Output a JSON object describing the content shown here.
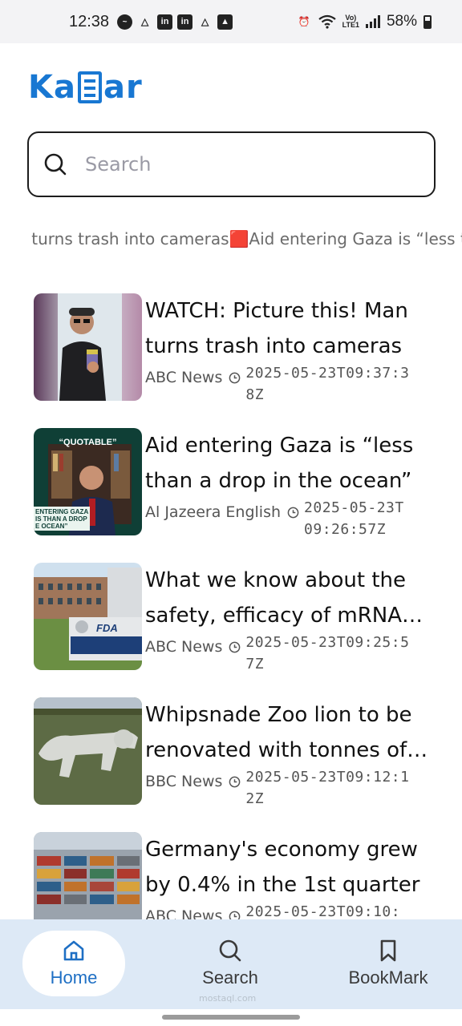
{
  "status_bar": {
    "time": "12:38",
    "battery": "58%",
    "network": "LTE1"
  },
  "app": {
    "logo_left": "Ka",
    "logo_right": "ar",
    "brand_color": "#1877d2"
  },
  "search": {
    "placeholder": "Search"
  },
  "ticker": {
    "text": "an turns trash into cameras🟥Aid entering Gaza is “less than a drop in the ocean”"
  },
  "articles": [
    {
      "title": "WATCH: Picture this! Man turns trash into cameras",
      "source": "ABC News",
      "time": "2025-05-23T09:37:38Z"
    },
    {
      "title": "Aid entering Gaza is “less than a drop in the ocean”",
      "source": "Al Jazeera English",
      "time": "2025-05-23T09:26:57Z",
      "thumb_caption": "“QUOTABLE”",
      "thumb_lower": "ENTERING GAZA IS THAN A DROP E OCEAN”"
    },
    {
      "title": "What we know about the safety, efficacy of mRNA vaccines",
      "source": "ABC News",
      "time": "2025-05-23T09:25:57Z",
      "thumb_sign": "FDA"
    },
    {
      "title": "Whipsnade Zoo lion to be renovated with tonnes of chalk",
      "source": "BBC News",
      "time": "2025-05-23T09:12:12Z"
    },
    {
      "title": "Germany's economy grew by 0.4% in the 1st quarter",
      "source": "ABC News",
      "time": "2025-05-23T09:10:"
    }
  ],
  "nav": {
    "home": "Home",
    "search": "Search",
    "bookmark": "BookMark",
    "watermark": "mostaql.com"
  },
  "colors": {
    "accent": "#1877d2",
    "nav_background": "#dde9f6",
    "active_label": "#1e6fc4"
  }
}
